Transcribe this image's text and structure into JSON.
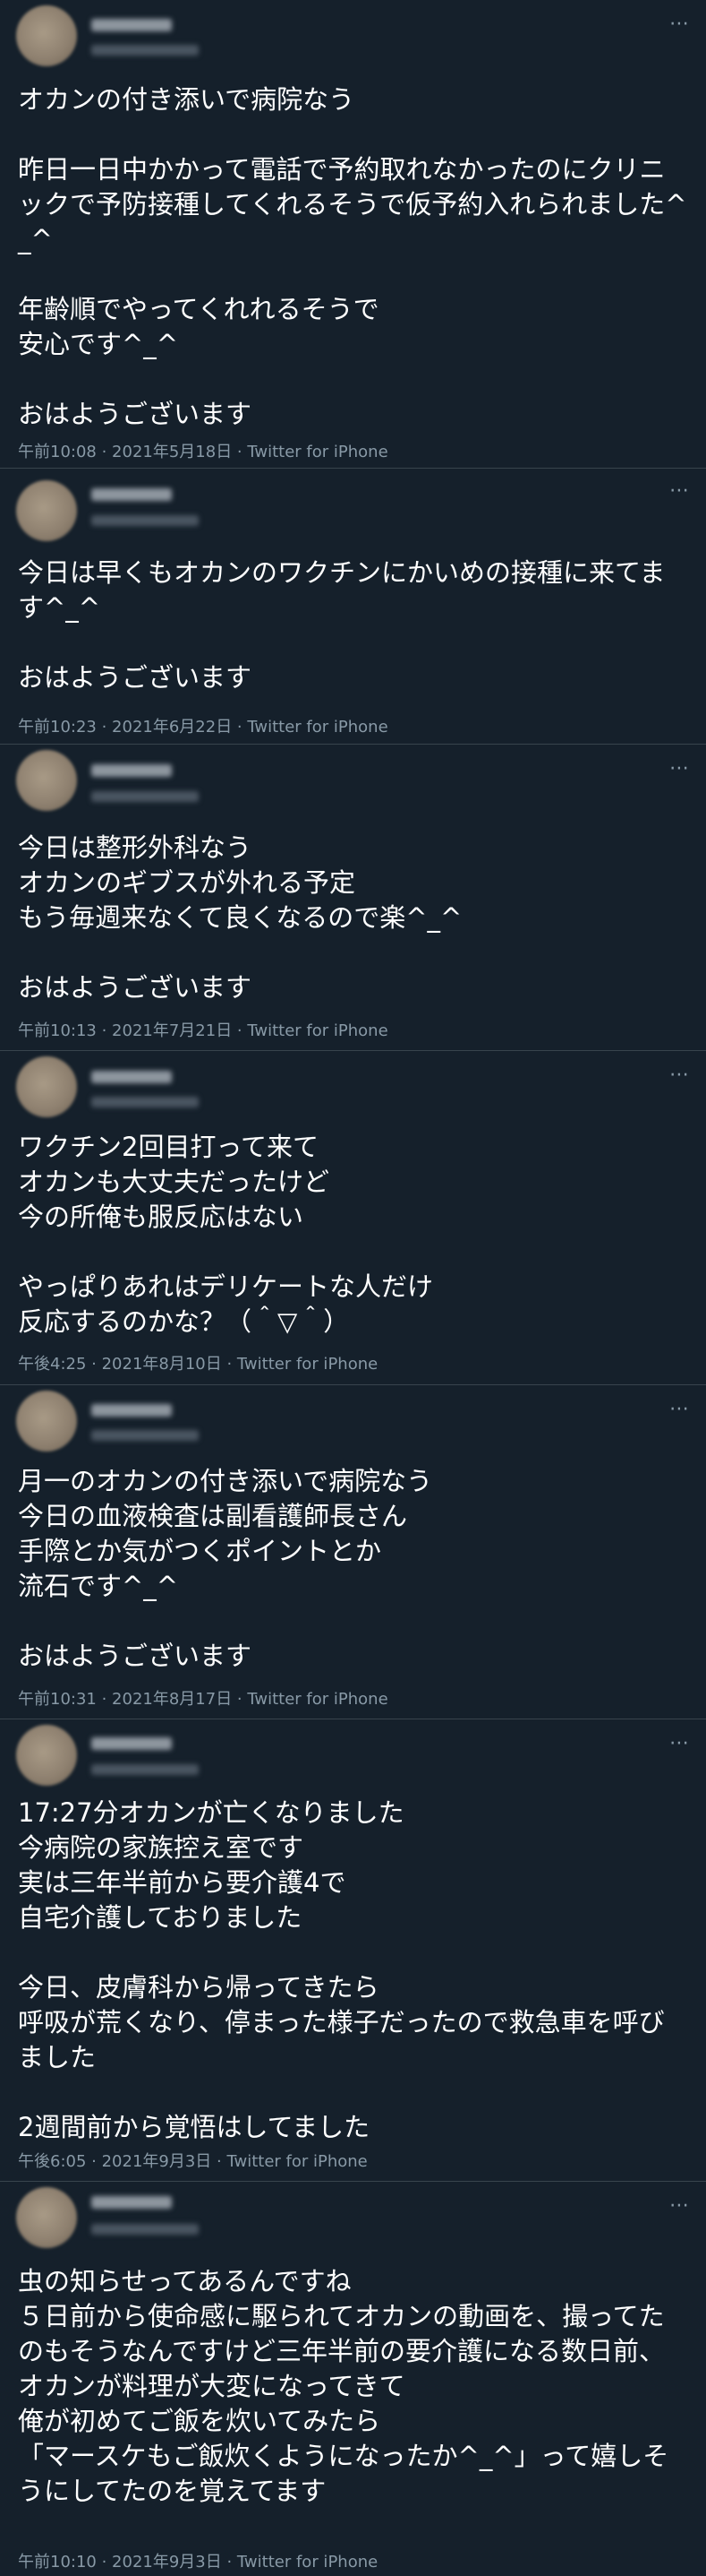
{
  "more_icon": "⋯",
  "tweets": [
    {
      "text": "オカンの付き添いで病院なう\n\n昨日一日中かかって電話で予約取れなかったのにクリニックで予防接種してくれるそうで仮予約入れられました^_^\n\n年齢順でやってくれれるそうで\n安心です^_^\n\nおはようございます",
      "meta": "午前10:08 · 2021年5月18日 · Twitter for iPhone"
    },
    {
      "text": "今日は早くもオカンのワクチンにかいめの接種に来てます^_^\n\nおはようございます",
      "meta": "午前10:23 · 2021年6月22日 · Twitter for iPhone"
    },
    {
      "text": "今日は整形外科なう\nオカンのギブスが外れる予定\nもう毎週来なくて良くなるので楽^_^\n\nおはようございます",
      "meta": "午前10:13 · 2021年7月21日 · Twitter for iPhone"
    },
    {
      "text": "ワクチン2回目打って来て\nオカンも大丈夫だったけど\n今の所俺も服反応はない\n\nやっぱりあれはデリケートな人だけ\n反応するのかな？（＾▽＾）",
      "meta": "午後4:25 · 2021年8月10日 · Twitter for iPhone"
    },
    {
      "text": "月一のオカンの付き添いで病院なう\n今日の血液検査は副看護師長さん\n手際とか気がつくポイントとか\n流石です^_^\n\nおはようございます",
      "meta": "午前10:31 · 2021年8月17日 · Twitter for iPhone"
    },
    {
      "text": "17:27分オカンが亡くなりました\n今病院の家族控え室です\n実は三年半前から要介護4で\n自宅介護しておりました\n\n今日、皮膚科から帰ってきたら\n呼吸が荒くなり、停まった様子だったので救急車を呼びました\n\n2週間前から覚悟はしてました",
      "meta": "午後6:05 · 2021年9月3日 · Twitter for iPhone"
    },
    {
      "text": "虫の知らせってあるんですね\n５日前から使命感に駆られてオカンの動画を、撮ってたのもそうなんですけど三年半前の要介護になる数日前、\nオカンが料理が大変になってきて\n俺が初めてご飯を炊いてみたら\n「マースケもご飯炊くようになったか^_^」って嬉しそうにしてたのを覚えてます",
      "meta": "午前10:10 · 2021年9月3日 · Twitter for iPhone"
    }
  ]
}
